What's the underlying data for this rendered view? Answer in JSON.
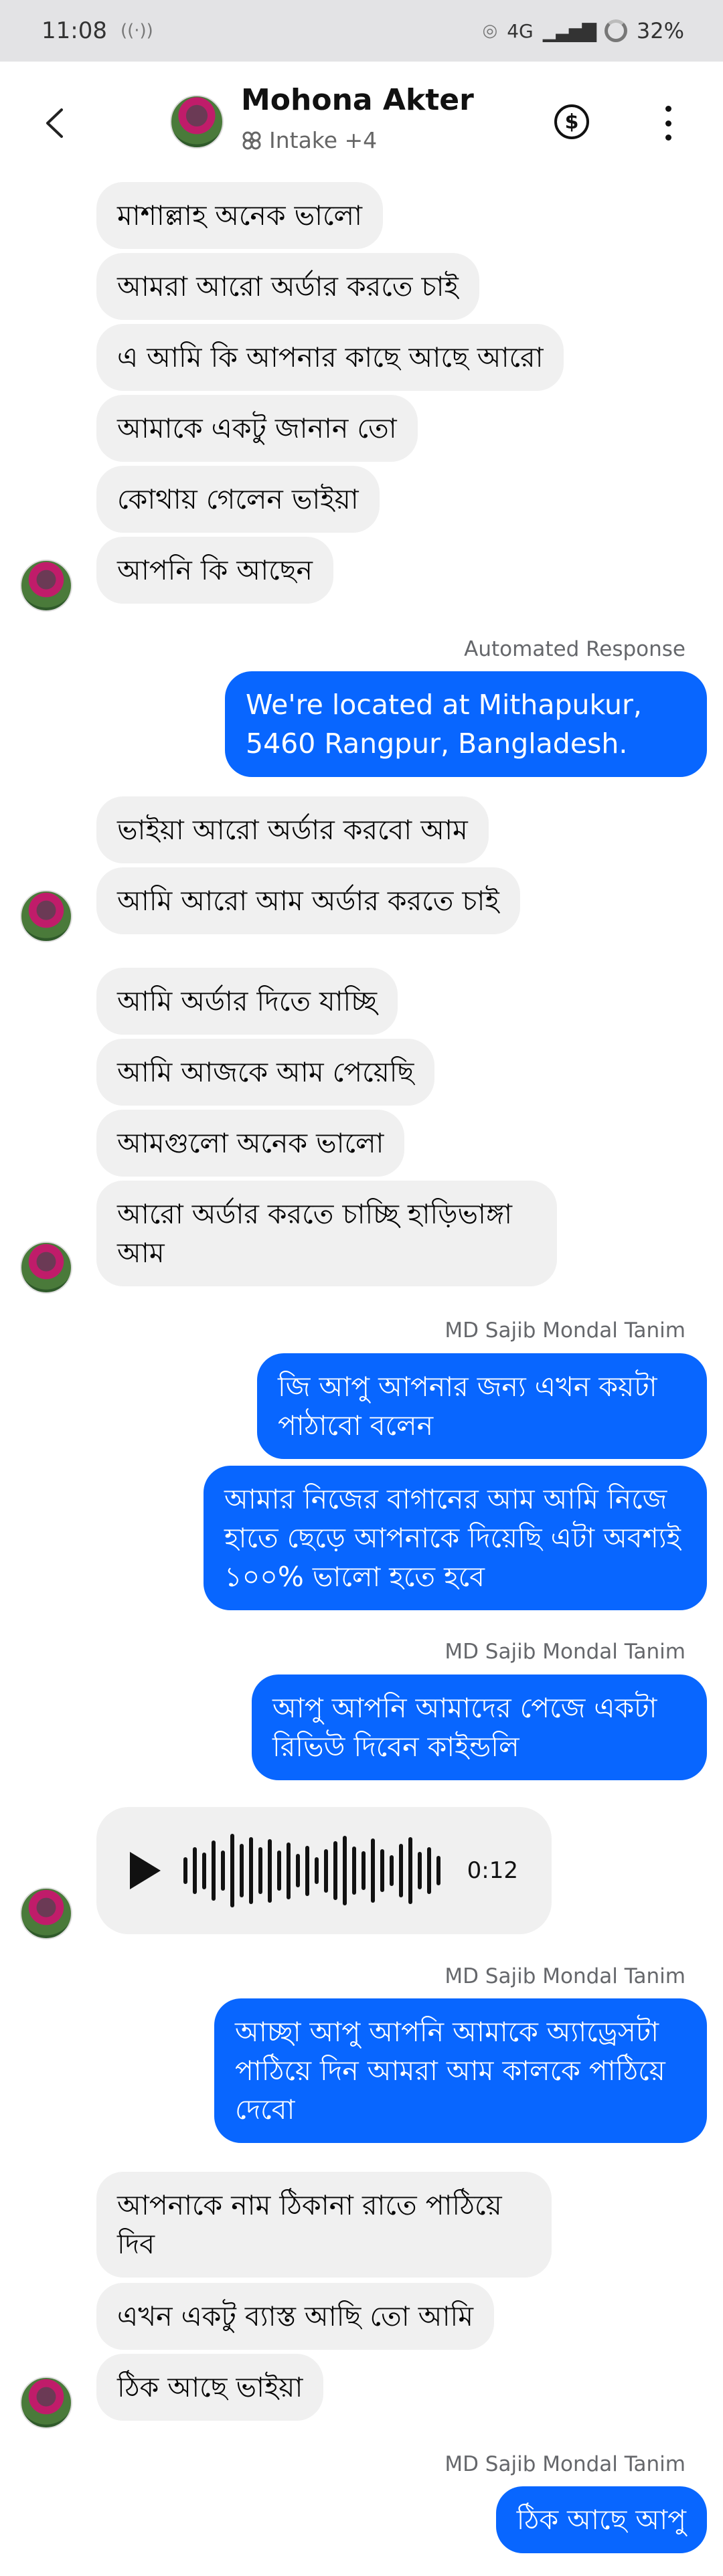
{
  "status": {
    "time": "11:08",
    "network": "4G",
    "battery": "32%"
  },
  "header": {
    "name": "Mohona Akter",
    "subtitle": "Intake +4"
  },
  "messages": {
    "m1": "মাশাল্লাহ  অনেক ভালো",
    "m2": "আমরা আরো অর্ডার করতে চাই",
    "m3": "এ আমি কি আপনার কাছে আছে আরো",
    "m4": "আমাকে একটু জানান তো",
    "m5": "কোথায় গেলেন ভাইয়া",
    "m6": "আপনি কি আছেন",
    "auto_label": "Automated Response",
    "m7": "We're located at Mithapukur, 5460 Rangpur, Bangladesh.",
    "m8": "ভাইয়া আরো অর্ডার করবো আম",
    "m9": "আমি আরো আম অর্ডার করতে চাই",
    "m10": "আমি অর্ডার দিতে যাচ্ছি",
    "m11": "আমি আজকে আম পেয়েছি",
    "m12": "আমগুলো অনেক ভালো",
    "m13": "আরো অর্ডার করতে চাচ্ছি হাড়িভাঙ্গা আম",
    "sender1": "MD Sajib Mondal Tanim",
    "m14": "জি আপু আপনার জন্য এখন কয়টা পাঠাবো বলেন",
    "m15": "আমার নিজের বাগানের আম আমি নিজে হাতে ছেড়ে আপনাকে দিয়েছি এটা অবশ্যই ১০০% ভালো হতে হবে",
    "sender2": "MD Sajib Mondal Tanim",
    "m16": "আপু আপনি আমাদের পেজে একটা রিভিউ দিবেন কাইন্ডলি",
    "voice_duration": "0:12",
    "sender3": "MD Sajib Mondal Tanim",
    "m17": "আচ্ছা আপু আপনি আমাকে অ্যাড্রেসটা পাঠিয়ে দিন আমরা আম কালকে পাঠিয়ে দেবো",
    "m18": "আপনাকে নাম ঠিকানা রাতে পাঠিয়ে দিব",
    "m19": "এখন একটু ব্যাস্ত আছি তো আমি",
    "m20": "ঠিক আছে ভাইয়া",
    "sender4": "MD Sajib Mondal Tanim",
    "m21": "ঠিক আছে আপু"
  },
  "colors": {
    "outgoing": "#0866ff",
    "incoming": "#f0f0f0",
    "meta": "#65676b"
  },
  "icons": [
    "back-chevron-icon",
    "intake-icon",
    "dollar-icon",
    "more-vertical-icon",
    "play-icon",
    "waveform-icon"
  ]
}
